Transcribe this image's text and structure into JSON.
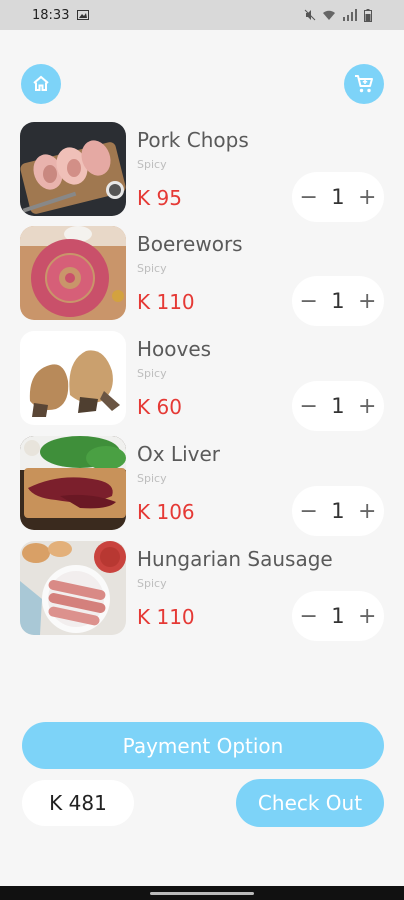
{
  "status": {
    "time": "18:33",
    "icons": [
      "image-icon",
      "mute-icon",
      "wifi-icon",
      "signal-icon",
      "battery-icon"
    ]
  },
  "header": {
    "home_icon": "home-icon",
    "cart_icon": "cart-icon"
  },
  "items": [
    {
      "name": "Pork Chops",
      "subtitle": "Spicy",
      "price": "K 95",
      "qty": "1",
      "minus": "−",
      "plus": "+"
    },
    {
      "name": "Boerewors",
      "subtitle": "Spicy",
      "price": "K 110",
      "qty": "1",
      "minus": "−",
      "plus": "+"
    },
    {
      "name": "Hooves",
      "subtitle": "Spicy",
      "price": "K 60",
      "qty": "1",
      "minus": "−",
      "plus": "+"
    },
    {
      "name": "Ox Liver",
      "subtitle": "Spicy",
      "price": "K 106",
      "qty": "1",
      "minus": "−",
      "plus": "+"
    },
    {
      "name": "Hungarian Sausage",
      "subtitle": "Spicy",
      "price": "K 110",
      "qty": "1",
      "minus": "−",
      "plus": "+"
    }
  ],
  "footer": {
    "payment_label": "Payment Option",
    "total": "K 481",
    "checkout_label": "Check Out"
  },
  "colors": {
    "accent": "#7dd3f8",
    "price": "#e53935",
    "background": "#f6f6f6"
  }
}
